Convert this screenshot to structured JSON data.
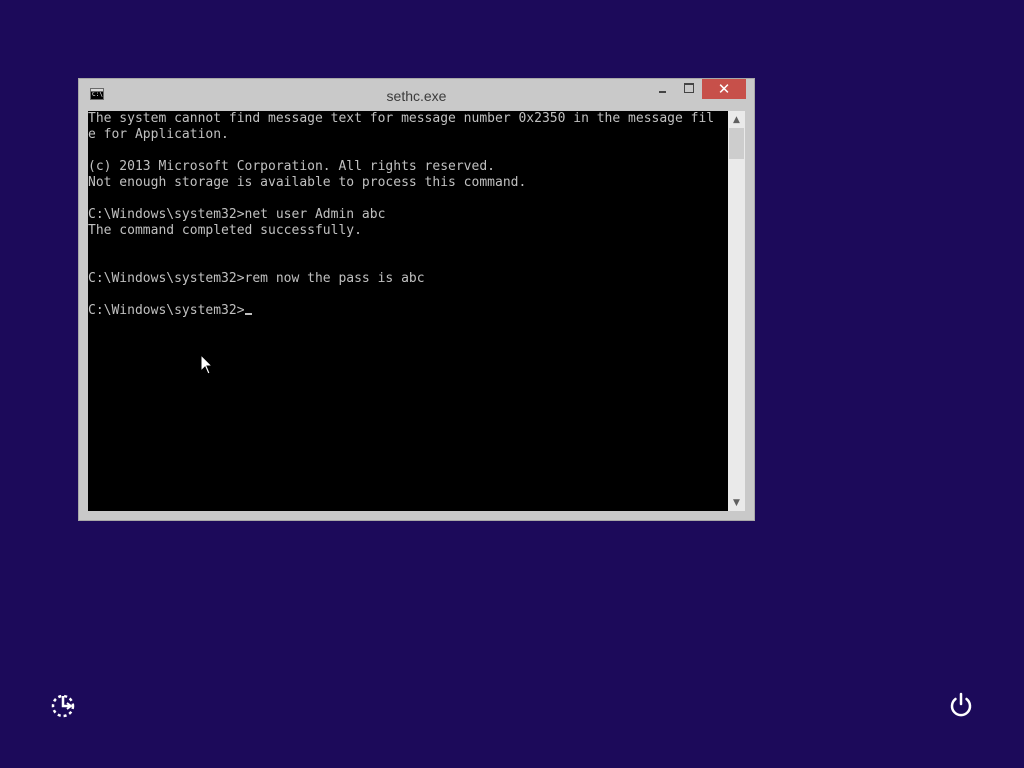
{
  "window": {
    "title": "sethc.exe",
    "icon": "cmd-icon",
    "controls": {
      "minimize": "minimize-icon",
      "maximize": "maximize-icon",
      "close": "✕"
    }
  },
  "console": {
    "lines": [
      "The system cannot find message text for message number 0x2350 in the message fil",
      "e for Application.",
      "",
      "(c) 2013 Microsoft Corporation. All rights reserved.",
      "Not enough storage is available to process this command.",
      "",
      "C:\\Windows\\system32>net user Admin abc",
      "The command completed successfully.",
      "",
      "",
      "C:\\Windows\\system32>rem now the pass is abc",
      "",
      "C:\\Windows\\system32>"
    ]
  },
  "scrollbar": {
    "up": "▲",
    "down": "▼"
  },
  "colors": {
    "background": "#1c0a5a",
    "window_frame": "#c9c9c9",
    "console_bg": "#000000",
    "console_text": "#c0c0c0",
    "close_button": "#c7504a"
  },
  "desktop": {
    "ease_of_access": "ease-of-access-icon",
    "power": "power-icon"
  }
}
